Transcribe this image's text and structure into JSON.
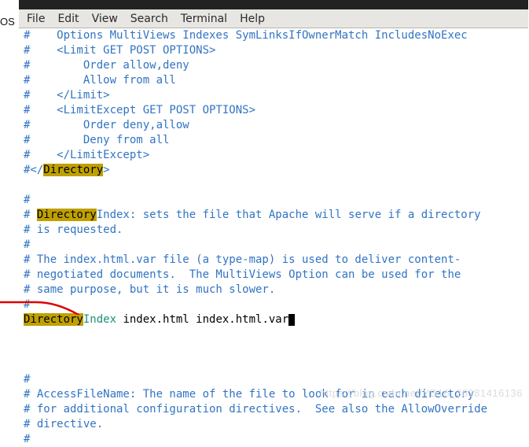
{
  "left_text": "OS",
  "menu": {
    "file": "File",
    "edit": "Edit",
    "view": "View",
    "search": "Search",
    "terminal": "Terminal",
    "help": "Help"
  },
  "lines": [
    {
      "segments": [
        {
          "t": "#    Options MultiViews Indexes SymLinksIfOwnerMatch IncludesNoExec",
          "c": "c"
        }
      ]
    },
    {
      "segments": [
        {
          "t": "#    <Limit GET POST OPTIONS>",
          "c": "c"
        }
      ]
    },
    {
      "segments": [
        {
          "t": "#        Order allow,deny",
          "c": "c"
        }
      ]
    },
    {
      "segments": [
        {
          "t": "#        Allow from all",
          "c": "c"
        }
      ]
    },
    {
      "segments": [
        {
          "t": "#    </Limit>",
          "c": "c"
        }
      ]
    },
    {
      "segments": [
        {
          "t": "#    <LimitExcept GET POST OPTIONS>",
          "c": "c"
        }
      ]
    },
    {
      "segments": [
        {
          "t": "#        Order deny,allow",
          "c": "c"
        }
      ]
    },
    {
      "segments": [
        {
          "t": "#        Deny from all",
          "c": "c"
        }
      ]
    },
    {
      "segments": [
        {
          "t": "#    </LimitExcept>",
          "c": "c"
        }
      ]
    },
    {
      "segments": [
        {
          "t": "#</",
          "c": "c"
        },
        {
          "t": "Directory",
          "c": "hl"
        },
        {
          "t": ">",
          "c": "c"
        }
      ]
    },
    {
      "segments": [
        {
          "t": "",
          "c": "c"
        }
      ]
    },
    {
      "segments": [
        {
          "t": "#",
          "c": "c"
        }
      ]
    },
    {
      "segments": [
        {
          "t": "# ",
          "c": "c"
        },
        {
          "t": "Directory",
          "c": "hl"
        },
        {
          "t": "Index: sets the file that Apache will serve if a directory",
          "c": "c"
        }
      ]
    },
    {
      "segments": [
        {
          "t": "# is requested.",
          "c": "c"
        }
      ]
    },
    {
      "segments": [
        {
          "t": "#",
          "c": "c"
        }
      ]
    },
    {
      "segments": [
        {
          "t": "# The index.html.var file (a type-map) is used to deliver content-",
          "c": "c"
        }
      ]
    },
    {
      "segments": [
        {
          "t": "# negotiated documents.  The MultiViews Option can be used for the",
          "c": "c"
        }
      ]
    },
    {
      "segments": [
        {
          "t": "# same purpose, but it is much slower.",
          "c": "c"
        }
      ]
    },
    {
      "segments": [
        {
          "t": "#",
          "c": "c"
        }
      ]
    },
    {
      "segments": [
        {
          "t": "Directory",
          "c": "hl"
        },
        {
          "t": "Index",
          "c": "di"
        },
        {
          "t": " index.html index.html.var",
          "c": "p"
        }
      ],
      "cursor": true
    },
    {
      "segments": [
        {
          "t": "",
          "c": "c"
        }
      ]
    },
    {
      "segments": [
        {
          "t": "",
          "c": "c"
        }
      ]
    },
    {
      "segments": [
        {
          "t": "",
          "c": "c"
        }
      ]
    },
    {
      "segments": [
        {
          "t": "#",
          "c": "c"
        }
      ]
    },
    {
      "segments": [
        {
          "t": "# AccessFileName: The name of the file to look for in each directory",
          "c": "c"
        }
      ]
    },
    {
      "segments": [
        {
          "t": "# for additional configuration directives.  See also the AllowOverride",
          "c": "c"
        }
      ]
    },
    {
      "segments": [
        {
          "t": "# directive.",
          "c": "c"
        }
      ]
    },
    {
      "segments": [
        {
          "t": "#",
          "c": "c"
        }
      ]
    }
  ],
  "watermark": "https://blog.csdn.net/YD16_38381416136"
}
